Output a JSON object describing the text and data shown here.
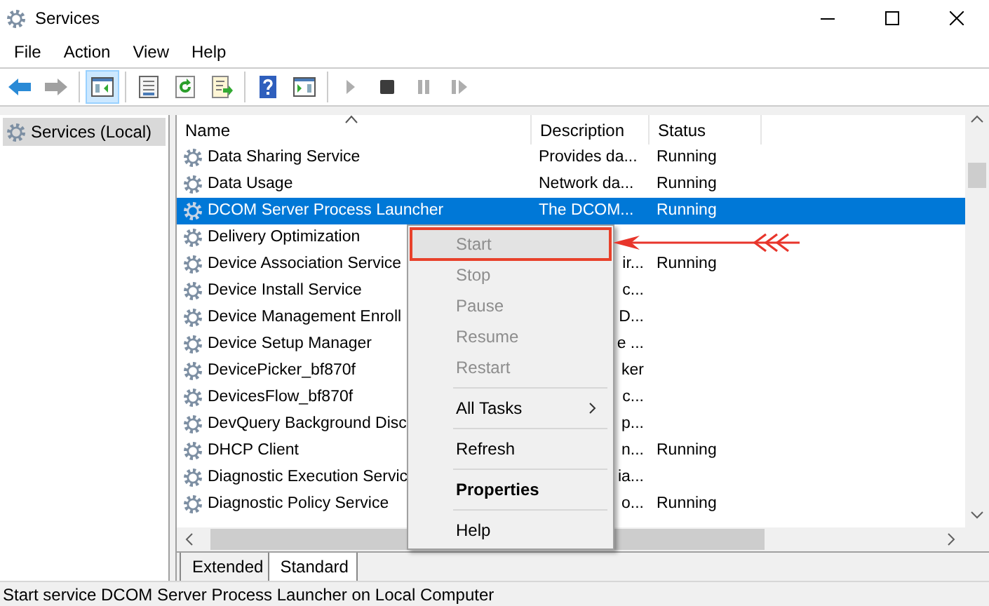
{
  "window": {
    "title": "Services"
  },
  "menu": [
    "File",
    "Action",
    "View",
    "Help"
  ],
  "toolbar": [
    {
      "kind": "back",
      "disabled": false,
      "selected": false
    },
    {
      "kind": "forward",
      "disabled": true,
      "selected": false
    },
    {
      "kind": "sep"
    },
    {
      "kind": "tree",
      "disabled": false,
      "selected": true
    },
    {
      "kind": "sep"
    },
    {
      "kind": "properties",
      "disabled": false,
      "selected": false
    },
    {
      "kind": "refresh",
      "disabled": false,
      "selected": false
    },
    {
      "kind": "export",
      "disabled": false,
      "selected": false
    },
    {
      "kind": "sep"
    },
    {
      "kind": "help",
      "disabled": false,
      "selected": false
    },
    {
      "kind": "pane",
      "disabled": false,
      "selected": false
    },
    {
      "kind": "sep"
    },
    {
      "kind": "play",
      "disabled": true,
      "selected": false
    },
    {
      "kind": "stop",
      "disabled": false,
      "selected": false
    },
    {
      "kind": "pause",
      "disabled": true,
      "selected": false
    },
    {
      "kind": "resume",
      "disabled": true,
      "selected": false
    }
  ],
  "tree": [
    {
      "label": "Services (Local)",
      "selected": true
    }
  ],
  "table": {
    "columns": [
      "Name",
      "Description",
      "Status"
    ],
    "rows": [
      {
        "name": "Data Sharing Service",
        "description": "Provides da...",
        "status": "Running",
        "selected": false
      },
      {
        "name": "Data Usage",
        "description": "Network da...",
        "status": "Running",
        "selected": false
      },
      {
        "name": "DCOM Server Process Launcher",
        "description": "The DCOM...",
        "status": "Running",
        "selected": true
      },
      {
        "name": "Delivery Optimization",
        "selected": false
      },
      {
        "name": "Device Association Service",
        "description": "ir...",
        "status": "Running",
        "selected": false
      },
      {
        "name": "Device Install Service",
        "description": "c...",
        "selected": false
      },
      {
        "name": "Device Management Enroll",
        "description": "D...",
        "selected": false
      },
      {
        "name": "Device Setup Manager",
        "description": "e ...",
        "selected": false
      },
      {
        "name": "DevicePicker_bf870f",
        "description": "ker",
        "selected": false
      },
      {
        "name": "DevicesFlow_bf870f",
        "description": "c...",
        "selected": false
      },
      {
        "name": "DevQuery Background Disc",
        "description": "p...",
        "selected": false
      },
      {
        "name": "DHCP Client",
        "description": "n...",
        "status": "Running",
        "selected": false
      },
      {
        "name": "Diagnostic Execution Servic",
        "description": "ia...",
        "selected": false
      },
      {
        "name": "Diagnostic Policy Service",
        "description": "o...",
        "status": "Running",
        "selected": false
      }
    ]
  },
  "context_menu": [
    {
      "kind": "item",
      "label": "Start",
      "disabled": true,
      "selected": true,
      "bold": false
    },
    {
      "kind": "item",
      "label": "Stop",
      "disabled": true,
      "selected": false,
      "bold": false
    },
    {
      "kind": "item",
      "label": "Pause",
      "disabled": true,
      "selected": false,
      "bold": false
    },
    {
      "kind": "item",
      "label": "Resume",
      "disabled": true,
      "selected": false,
      "bold": false
    },
    {
      "kind": "item",
      "label": "Restart",
      "disabled": true,
      "selected": false,
      "bold": false
    },
    {
      "kind": "separator"
    },
    {
      "kind": "submenu",
      "label": "All Tasks",
      "disabled": false,
      "selected": false,
      "bold": false
    },
    {
      "kind": "separator"
    },
    {
      "kind": "item",
      "label": "Refresh",
      "disabled": false,
      "selected": false,
      "bold": false
    },
    {
      "kind": "separator"
    },
    {
      "kind": "item",
      "label": "Properties",
      "disabled": false,
      "selected": false,
      "bold": true
    },
    {
      "kind": "separator"
    },
    {
      "kind": "item",
      "label": "Help",
      "disabled": false,
      "selected": false,
      "bold": false
    }
  ],
  "view_tabs": [
    {
      "label": "Extended",
      "selected": false
    },
    {
      "label": "Standard",
      "selected": true
    }
  ],
  "status_bar": "Start service DCOM Server Process Launcher on Local Computer"
}
